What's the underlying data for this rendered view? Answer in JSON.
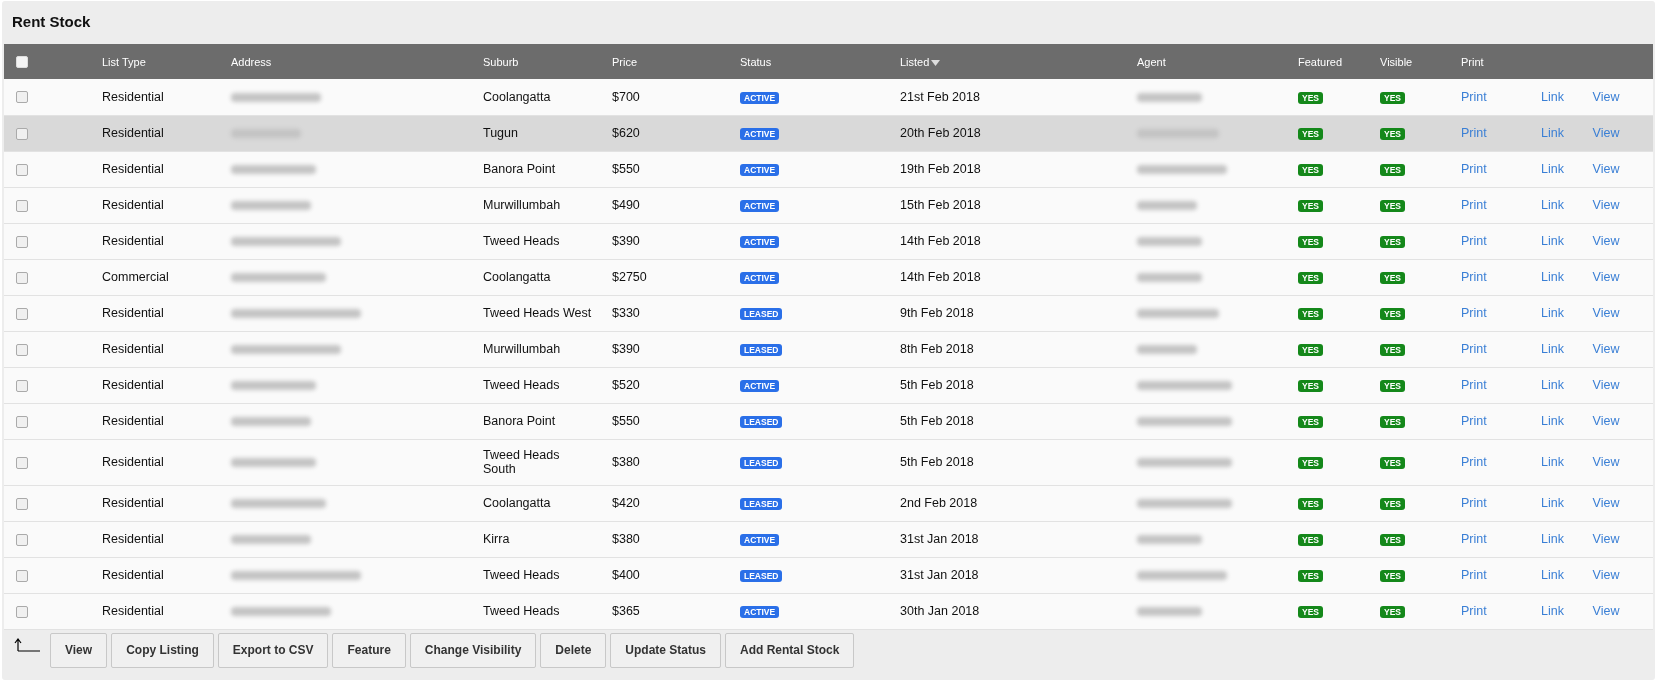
{
  "title": "Rent Stock",
  "columns": [
    {
      "label": "List Type"
    },
    {
      "label": "Address"
    },
    {
      "label": "Suburb"
    },
    {
      "label": "Price"
    },
    {
      "label": "Status"
    },
    {
      "label": "Listed",
      "sorted": true
    },
    {
      "label": "Agent"
    },
    {
      "label": "Featured"
    },
    {
      "label": "Visible"
    },
    {
      "label": "Print"
    }
  ],
  "select_all": {
    "checked": false
  },
  "rows": [
    {
      "checked": false,
      "highlighted": false,
      "list_type": "Residential",
      "suburb": "Coolangatta",
      "price": "$700",
      "status": "ACTIVE",
      "listed": "21st Feb 2018",
      "featured": "YES",
      "visible": "YES",
      "print": "Print",
      "link": "Link",
      "view": "View"
    },
    {
      "checked": false,
      "highlighted": true,
      "list_type": "Residential",
      "suburb": "Tugun",
      "price": "$620",
      "status": "ACTIVE",
      "listed": "20th Feb 2018",
      "featured": "YES",
      "visible": "YES",
      "print": "Print",
      "link": "Link",
      "view": "View"
    },
    {
      "checked": false,
      "highlighted": false,
      "list_type": "Residential",
      "suburb": "Banora Point",
      "price": "$550",
      "status": "ACTIVE",
      "listed": "19th Feb 2018",
      "featured": "YES",
      "visible": "YES",
      "print": "Print",
      "link": "Link",
      "view": "View"
    },
    {
      "checked": false,
      "highlighted": false,
      "list_type": "Residential",
      "suburb": "Murwillumbah",
      "price": "$490",
      "status": "ACTIVE",
      "listed": "15th Feb 2018",
      "featured": "YES",
      "visible": "YES",
      "print": "Print",
      "link": "Link",
      "view": "View"
    },
    {
      "checked": false,
      "highlighted": false,
      "list_type": "Residential",
      "suburb": "Tweed Heads",
      "price": "$390",
      "status": "ACTIVE",
      "listed": "14th Feb 2018",
      "featured": "YES",
      "visible": "YES",
      "print": "Print",
      "link": "Link",
      "view": "View"
    },
    {
      "checked": false,
      "highlighted": false,
      "list_type": "Commercial",
      "suburb": "Coolangatta",
      "price": "$2750",
      "status": "ACTIVE",
      "listed": "14th Feb 2018",
      "featured": "YES",
      "visible": "YES",
      "print": "Print",
      "link": "Link",
      "view": "View"
    },
    {
      "checked": false,
      "highlighted": false,
      "list_type": "Residential",
      "suburb": "Tweed Heads West",
      "price": "$330",
      "status": "LEASED",
      "listed": "9th Feb 2018",
      "featured": "YES",
      "visible": "YES",
      "print": "Print",
      "link": "Link",
      "view": "View"
    },
    {
      "checked": false,
      "highlighted": false,
      "list_type": "Residential",
      "suburb": "Murwillumbah",
      "price": "$390",
      "status": "LEASED",
      "listed": "8th Feb 2018",
      "featured": "YES",
      "visible": "YES",
      "print": "Print",
      "link": "Link",
      "view": "View"
    },
    {
      "checked": false,
      "highlighted": false,
      "list_type": "Residential",
      "suburb": "Tweed Heads",
      "price": "$520",
      "status": "ACTIVE",
      "listed": "5th Feb 2018",
      "featured": "YES",
      "visible": "YES",
      "print": "Print",
      "link": "Link",
      "view": "View"
    },
    {
      "checked": false,
      "highlighted": false,
      "list_type": "Residential",
      "suburb": "Banora Point",
      "price": "$550",
      "status": "LEASED",
      "listed": "5th Feb 2018",
      "featured": "YES",
      "visible": "YES",
      "print": "Print",
      "link": "Link",
      "view": "View"
    },
    {
      "checked": false,
      "highlighted": false,
      "list_type": "Residential",
      "suburb": "Tweed Heads South",
      "price": "$380",
      "status": "LEASED",
      "listed": "5th Feb 2018",
      "featured": "YES",
      "visible": "YES",
      "print": "Print",
      "link": "Link",
      "view": "View"
    },
    {
      "checked": false,
      "highlighted": false,
      "list_type": "Residential",
      "suburb": "Coolangatta",
      "price": "$420",
      "status": "LEASED",
      "listed": "2nd Feb 2018",
      "featured": "YES",
      "visible": "YES",
      "print": "Print",
      "link": "Link",
      "view": "View"
    },
    {
      "checked": false,
      "highlighted": false,
      "list_type": "Residential",
      "suburb": "Kirra",
      "price": "$380",
      "status": "ACTIVE",
      "listed": "31st Jan 2018",
      "featured": "YES",
      "visible": "YES",
      "print": "Print",
      "link": "Link",
      "view": "View"
    },
    {
      "checked": false,
      "highlighted": false,
      "list_type": "Residential",
      "suburb": "Tweed Heads",
      "price": "$400",
      "status": "LEASED",
      "listed": "31st Jan 2018",
      "featured": "YES",
      "visible": "YES",
      "print": "Print",
      "link": "Link",
      "view": "View"
    },
    {
      "checked": false,
      "highlighted": false,
      "list_type": "Residential",
      "suburb": "Tweed Heads",
      "price": "$365",
      "status": "ACTIVE",
      "listed": "30th Jan 2018",
      "featured": "YES",
      "visible": "YES",
      "print": "Print",
      "link": "Link",
      "view": "View"
    }
  ],
  "actions": [
    "View",
    "Copy Listing",
    "Export to CSV",
    "Feature",
    "Change Visibility",
    "Delete",
    "Update Status",
    "Add Rental Stock"
  ]
}
